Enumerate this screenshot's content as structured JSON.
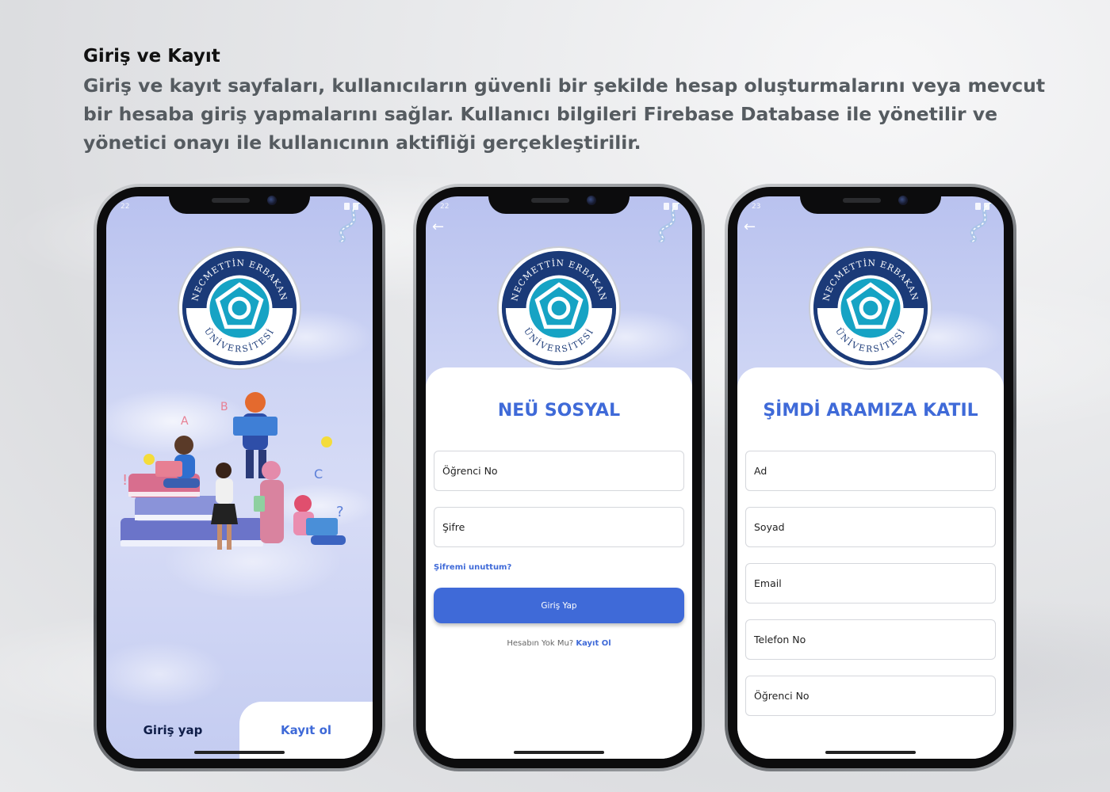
{
  "header": {
    "title": "Giriş ve Kayıt",
    "description": "Giriş ve kayıt sayfaları, kullanıcıların güvenli bir şekilde hesap oluşturmalarını veya mevcut bir hesaba giriş yapmalarını sağlar. Kullanıcı bilgileri Firebase Database ile yönetilir ve yönetici onayı ile kullanıcının aktifliği gerçekleştirilir."
  },
  "logo": {
    "top_text": "NECMETTİN ERBAKAN",
    "bottom_text": "ÜNİVERSİTESİ"
  },
  "welcome_screen": {
    "status_time": "22",
    "login_tab": "Giriş yap",
    "register_tab": "Kayıt ol"
  },
  "login_screen": {
    "status_time": "22",
    "title": "NEÜ SOSYAL",
    "student_no_label": "Öğrenci No",
    "password_label": "Şifre",
    "forgot_label": "Şifremi unuttum?",
    "login_button": "Giriş Yap",
    "no_account_text": "Hesabın Yok Mu?",
    "register_link": "Kayıt Ol"
  },
  "register_screen": {
    "status_time": "23",
    "title": "ŞİMDİ ARAMIZA KATIL",
    "fields": [
      "Ad",
      "Soyad",
      "Email",
      "Telefon No",
      "Öğrenci No"
    ]
  },
  "colors": {
    "accent": "#3f6ad8",
    "dark_navy": "#0f1d48",
    "logo_navy": "#1b3a78",
    "logo_teal": "#16a3c4"
  }
}
